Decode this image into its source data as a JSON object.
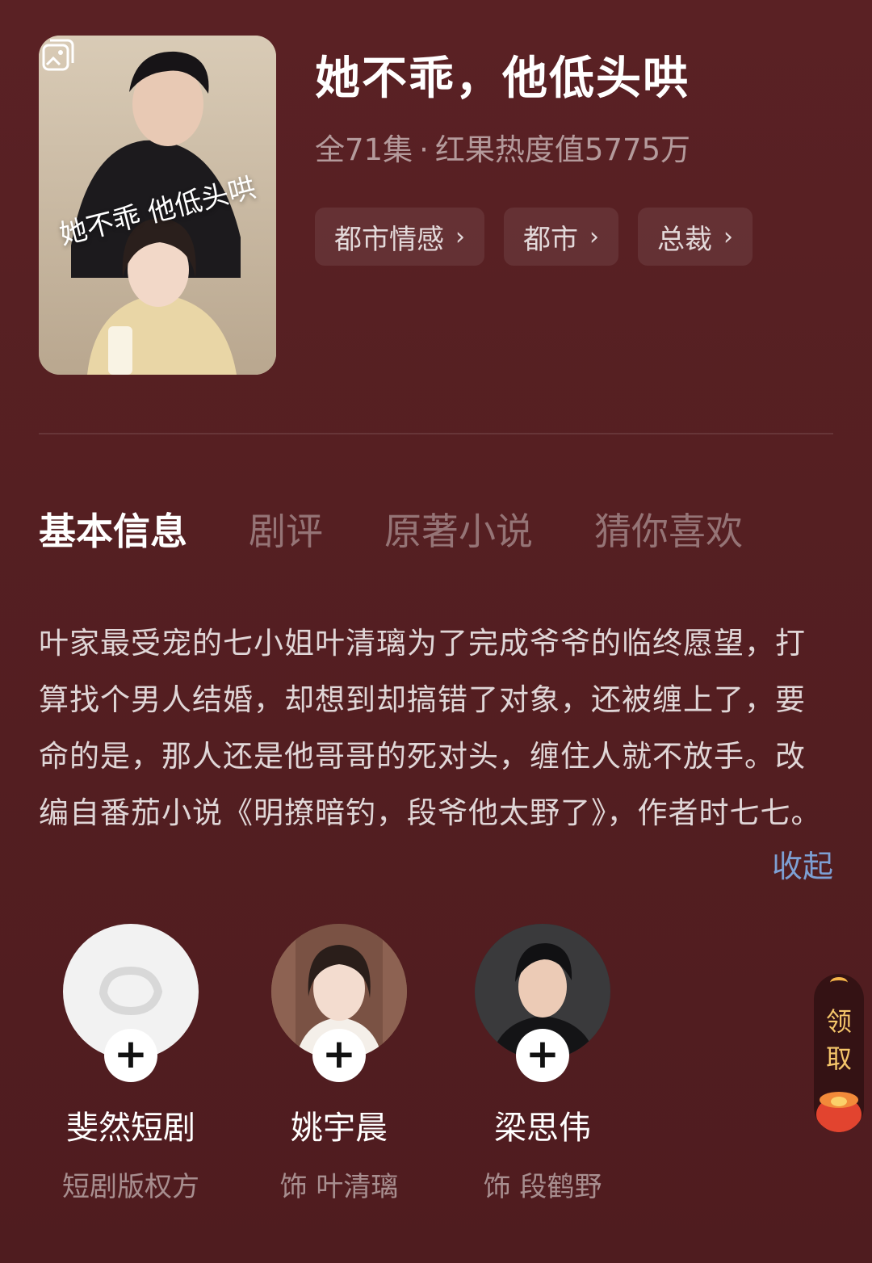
{
  "drama": {
    "title": "她不乖，他低头哄",
    "episodes": "全71集",
    "separator": "·",
    "heat": "红果热度值5775万",
    "poster": {
      "calligraphy": "她不乖 他低头哄"
    }
  },
  "tags": [
    {
      "label": "都市情感"
    },
    {
      "label": "都市"
    },
    {
      "label": "总裁"
    }
  ],
  "tabs": [
    {
      "label": "基本信息",
      "active": true
    },
    {
      "label": "剧评",
      "active": false
    },
    {
      "label": "原著小说",
      "active": false
    },
    {
      "label": "猜你喜欢",
      "active": false
    }
  ],
  "synopsis": "叶家最受宠的七小姐叶清璃为了完成爷爷的临终愿望，打算找个男人结婚，却想到却搞错了对象，还被缠上了，要命的是，那人还是他哥哥的死对头，缠住人就不放手。改编自番茄小说《明撩暗钓，段爷他太野了》，作者时七七。",
  "collapse_label": "收起",
  "cast": [
    {
      "name": "斐然短剧",
      "role": "短剧版权方",
      "avatar": "studio-logo"
    },
    {
      "name": "姚宇晨",
      "role": "饰 叶清璃",
      "avatar": "actress-photo"
    },
    {
      "name": "梁思伟",
      "role": "饰 段鹤野",
      "avatar": "actor-photo"
    }
  ],
  "cast_add_symbol": "+",
  "reward_widget": {
    "line1": "领",
    "line2": "取"
  },
  "colors": {
    "background": "#551f22",
    "link": "#7da0d4",
    "reward": "#f5c66a"
  }
}
